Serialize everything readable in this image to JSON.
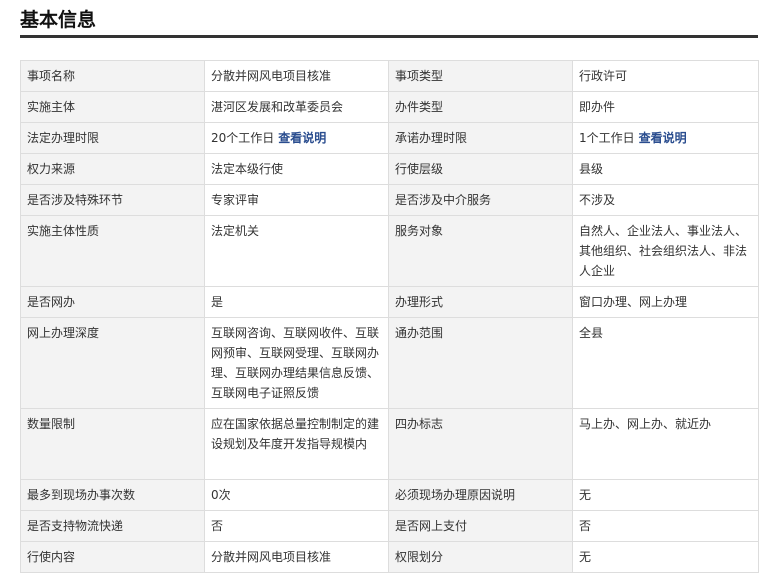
{
  "section": {
    "title": "基本信息"
  },
  "rows": [
    {
      "l1": "事项名称",
      "v1": "分散并网风电项目核准",
      "l2": "事项类型",
      "v2": "行政许可"
    },
    {
      "l1": "实施主体",
      "v1": "湛河区发展和改革委员会",
      "l2": "办件类型",
      "v2": "即办件"
    },
    {
      "l1": "法定办理时限",
      "v1": "20个工作日",
      "v1_link": "查看说明",
      "l2": "承诺办理时限",
      "v2": "1个工作日",
      "v2_link": "查看说明"
    },
    {
      "l1": "权力来源",
      "v1": "法定本级行使",
      "l2": "行使层级",
      "v2": "县级"
    },
    {
      "l1": "是否涉及特殊环节",
      "v1": "专家评审",
      "l2": "是否涉及中介服务",
      "v2": "不涉及"
    },
    {
      "l1": "实施主体性质",
      "v1": "法定机关",
      "l2": "服务对象",
      "v2": "自然人、企业法人、事业法人、其他组织、社会组织法人、非法人企业"
    },
    {
      "l1": "是否网办",
      "v1": "是",
      "l2": "办理形式",
      "v2": "窗口办理、网上办理"
    },
    {
      "l1": "网上办理深度",
      "v1": "互联网咨询、互联网收件、互联网预审、互联网受理、互联网办理、互联网办理结果信息反馈、互联网电子证照反馈",
      "l2": "通办范围",
      "v2": "全县"
    },
    {
      "l1": "数量限制",
      "v1": "应在国家依据总量控制制定的建设规划及年度开发指导规模内",
      "l2": "四办标志",
      "v2": "马上办、网上办、就近办"
    },
    {
      "l1": "最多到现场办事次数",
      "v1": "0次",
      "l2": "必须现场办理原因说明",
      "v2": "无"
    },
    {
      "l1": "是否支持物流快递",
      "v1": "否",
      "l2": "是否网上支付",
      "v2": "否"
    },
    {
      "l1": "行使内容",
      "v1": "分散并网风电项目核准",
      "l2": "权限划分",
      "v2": "无"
    }
  ]
}
